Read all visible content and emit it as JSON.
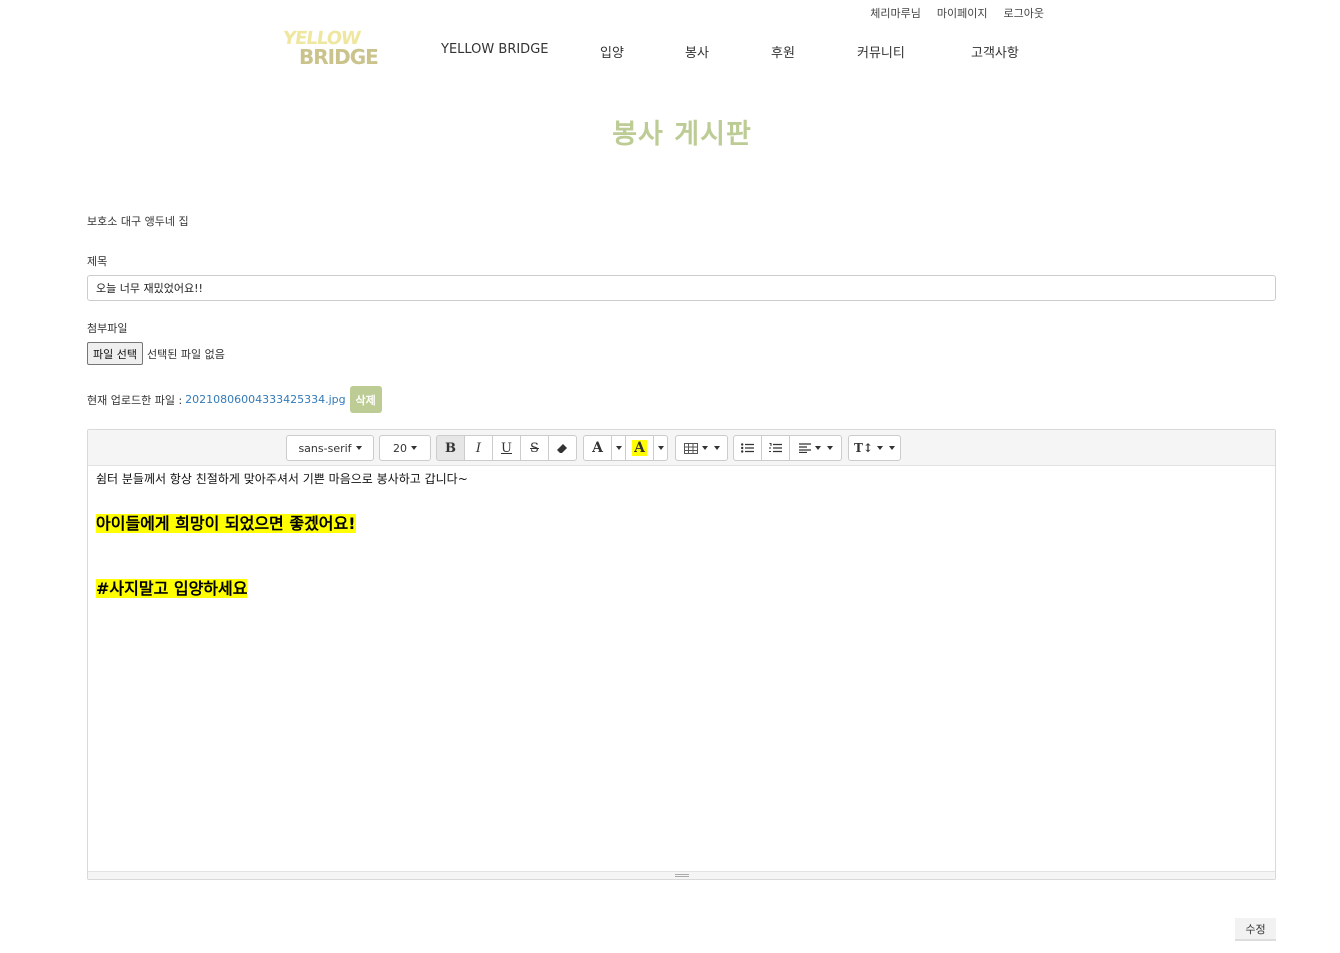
{
  "topbar": {
    "user": "체리마루님",
    "mypage": "마이페이지",
    "logout": "로그아웃"
  },
  "logo": {
    "line1": "YELLOW",
    "line2": "BRIDGE"
  },
  "nav": [
    "YELLOW BRIDGE",
    "입양",
    "봉사",
    "후원",
    "커뮤니티",
    "고객사항"
  ],
  "page_title": "봉사 게시판",
  "form": {
    "shelter": "보호소 대구 앵두네 집",
    "title_label": "제목",
    "title_value": "오늘 너무 재밌었어요!!",
    "attach_label": "첨부파일",
    "file_button": "파일 선택",
    "file_status": "선택된 파일 없음",
    "current_label": "현재 업로드한 파일 :",
    "current_file": "20210806004333425334.jpg",
    "delete_button": "삭제",
    "save_button": "수정"
  },
  "editor": {
    "font_family": "sans-serif",
    "font_size": "20",
    "bold": "B",
    "italic": "I",
    "underline": "U",
    "strike": "S",
    "fore_color_letter": "A",
    "back_color_letter": "A",
    "highlight_color": "#ffff00",
    "line_height": "T↕",
    "content": {
      "line1": "쉼터 분들께서 항상 친절하게 맞아주셔서 기쁜 마음으로 봉사하고 갑니다~",
      "line2": "아이들에게 희망이 되었으면 좋겠어요!",
      "line3": "#사지말고 입양하세요"
    }
  },
  "colors": {
    "accent": "#bccc94",
    "link": "#337ab7"
  }
}
